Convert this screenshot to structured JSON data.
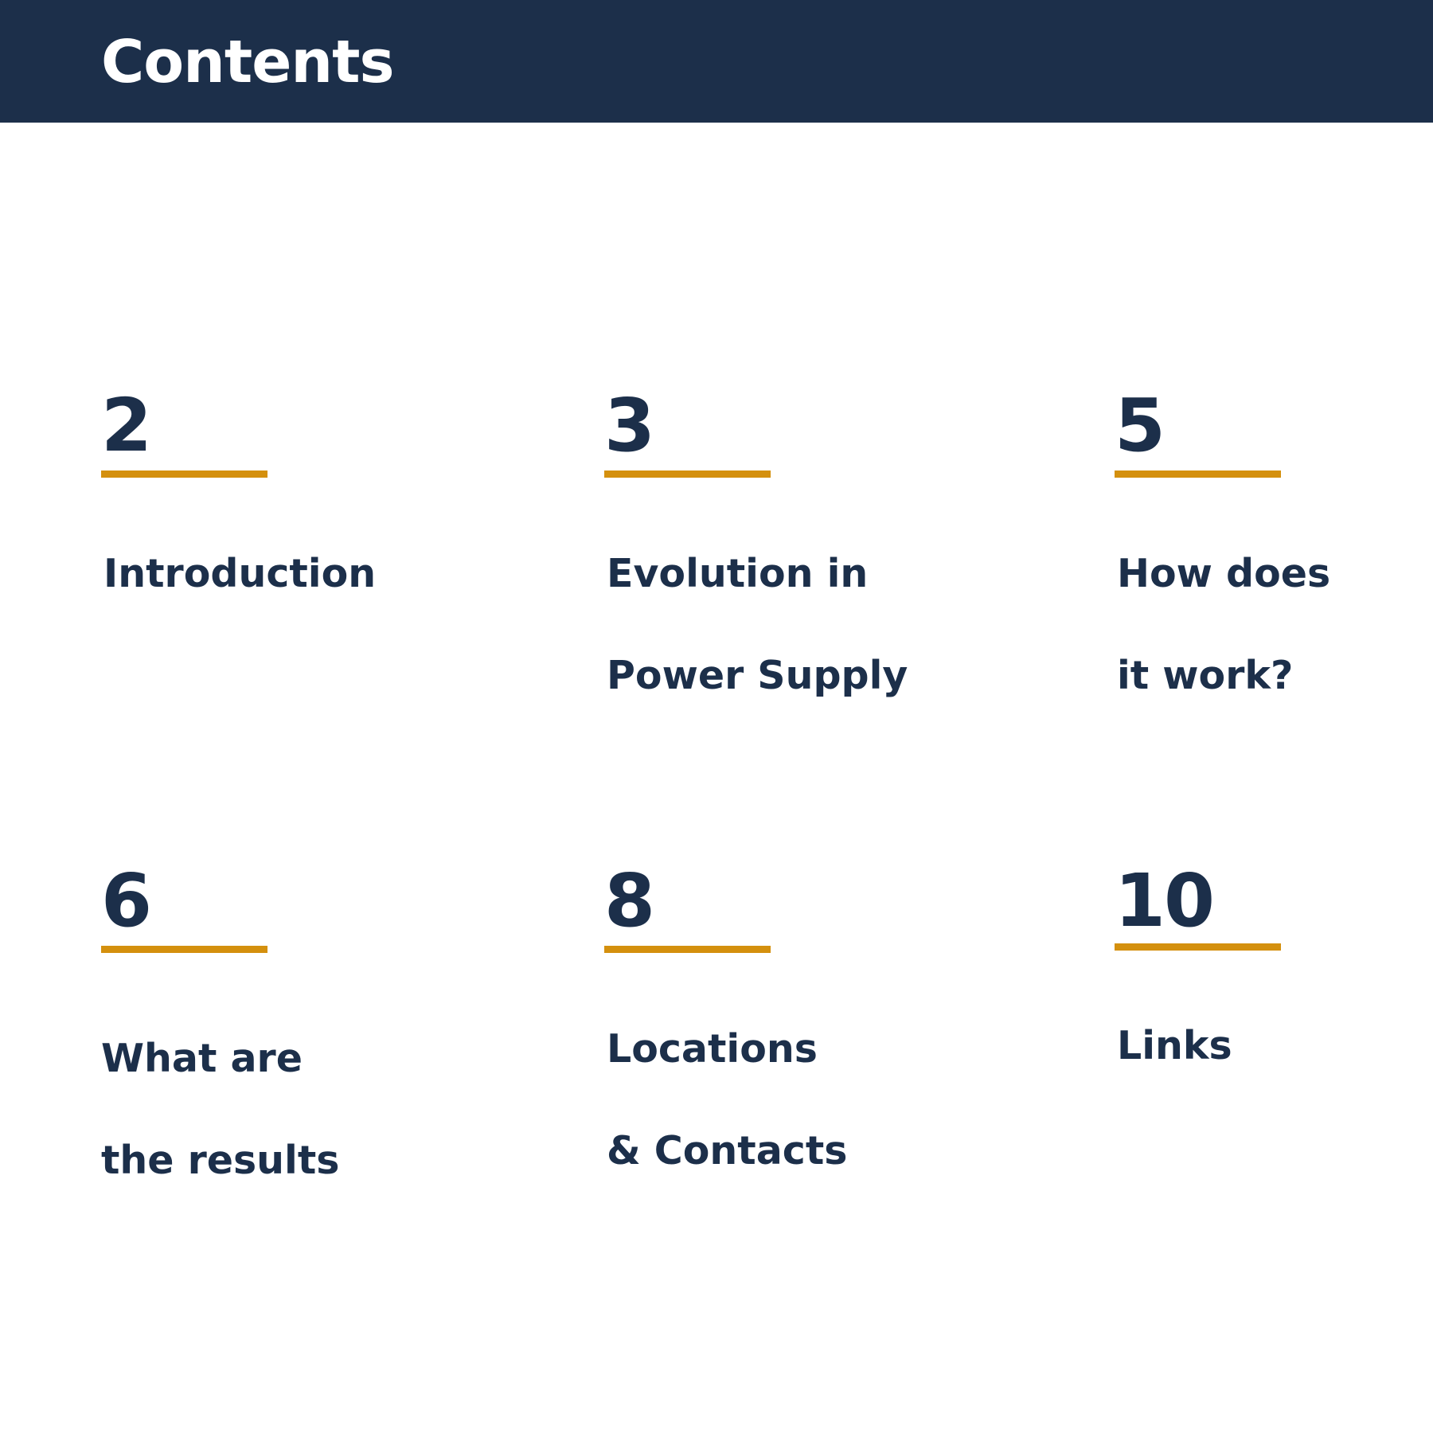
{
  "header": {
    "title": "Contents"
  },
  "colors": {
    "header_background": "#1c2f4a",
    "header_text": "#ffffff",
    "text": "#1c2f4a",
    "accent_rule": "#d4900e",
    "page_background": "#ffffff"
  },
  "toc": {
    "items": [
      {
        "number": "2",
        "label_lines": [
          "Introduction"
        ]
      },
      {
        "number": "3",
        "label_lines": [
          "Evolution in",
          "Power Supply"
        ]
      },
      {
        "number": "5",
        "label_lines": [
          "How does",
          "it work?"
        ]
      },
      {
        "number": "6",
        "label_lines": [
          "What are",
          "the results"
        ]
      },
      {
        "number": "8",
        "label_lines": [
          "Locations",
          "& Contacts"
        ]
      },
      {
        "number": "10",
        "label_lines": [
          "Links"
        ]
      }
    ]
  }
}
